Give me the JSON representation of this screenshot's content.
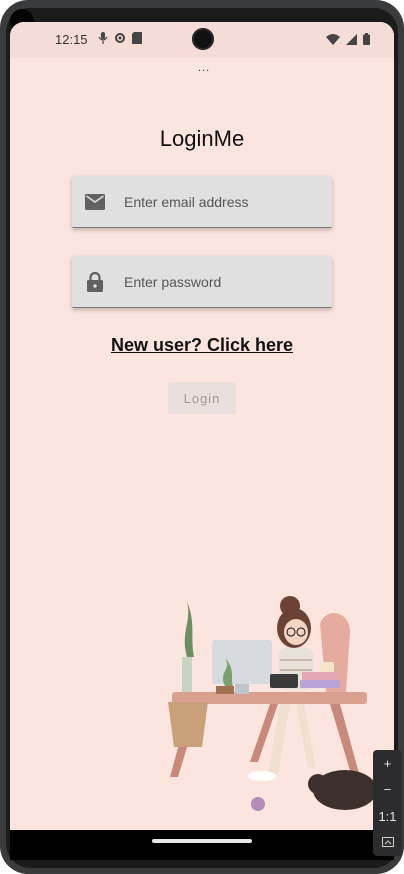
{
  "status_bar": {
    "time": "12:15"
  },
  "overflow_dots": "...",
  "app": {
    "title": "LoginMe",
    "email": {
      "placeholder": "Enter email address",
      "value": ""
    },
    "password": {
      "placeholder": "Enter password",
      "value": ""
    },
    "signup_link": "New user? Click here",
    "login_label": "Login"
  },
  "zoom_panel": {
    "zoom_in": "+",
    "zoom_out": "−",
    "actual_size": "1:1"
  },
  "colors": {
    "screen_bg": "#fde5df",
    "field_bg": "#e0e0e0",
    "login_disabled_text": "#9a9a9a"
  },
  "icons": [
    "mail-icon",
    "lock-icon",
    "wifi-icon",
    "signal-icon",
    "battery-icon",
    "settings-icon",
    "sd-card-icon",
    "mic-icon"
  ]
}
